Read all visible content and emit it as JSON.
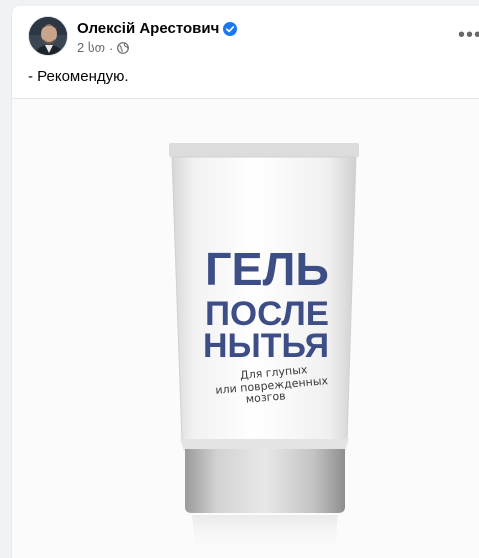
{
  "post": {
    "author": "Олексій Арестович",
    "verified": true,
    "time": "2 სთ",
    "separator": "·",
    "audience_icon": "globe-icon",
    "more_icon": "more-dots-icon",
    "more_label": "•••",
    "text": "- Рекомендую."
  },
  "image": {
    "tube_lines": [
      "ГЕЛЬ",
      "ПОСЛЕ",
      "НЫТЬЯ"
    ],
    "sub_lines": [
      "Для глупых",
      "или поврежденных",
      "мозгов"
    ]
  },
  "colors": {
    "accent_blue": "#1877f2",
    "tube_text": "#3d4e86",
    "name_text": "#050505",
    "meta_text": "#65676b"
  }
}
